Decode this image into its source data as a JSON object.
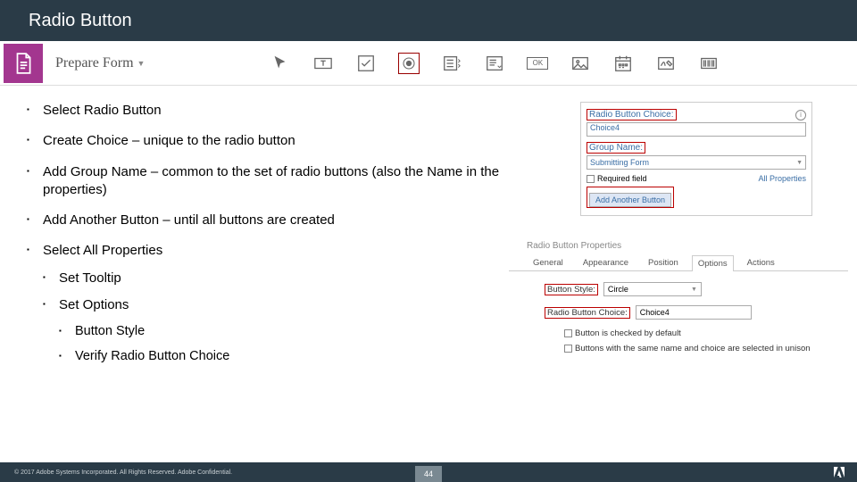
{
  "title": "Radio Button",
  "toolbar": {
    "prepare_label": "Prepare Form",
    "ok_label": "OK",
    "icons": [
      "pointer",
      "text-field",
      "checkbox",
      "radio",
      "list-box",
      "dropdown",
      "ok-button",
      "image",
      "date",
      "signature",
      "barcode"
    ]
  },
  "bullets": [
    "Select Radio Button",
    "Create Choice – unique to the radio button",
    "Add Group Name – common to the set of radio buttons (also the Name in the properties)",
    "Add Another Button – until all buttons are created",
    "Select All Properties"
  ],
  "sub1": [
    "Set Tooltip",
    "Set Options"
  ],
  "sub2": [
    "Button Style",
    "Verify Radio Button Choice"
  ],
  "panel1": {
    "choice_label": "Radio Button Choice:",
    "choice_value": "Choice4",
    "group_label": "Group Name:",
    "group_value": "Submitting Form",
    "required": "Required field",
    "all_props": "All Properties",
    "add_another": "Add Another Button"
  },
  "panel2": {
    "title": "Radio Button Properties",
    "tabs": [
      "General",
      "Appearance",
      "Position",
      "Options",
      "Actions"
    ],
    "active_tab": "Options",
    "style_label": "Button Style:",
    "style_value": "Circle",
    "choice_label": "Radio Button Choice:",
    "choice_value": "Choice4",
    "opt1": "Button is checked by default",
    "opt2": "Buttons with the same name and choice are selected in unison"
  },
  "footer": {
    "copyright": "© 2017 Adobe Systems Incorporated.  All Rights Reserved.  Adobe Confidential.",
    "page": "44"
  }
}
